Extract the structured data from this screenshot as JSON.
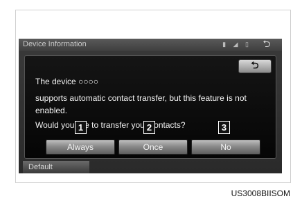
{
  "screen": {
    "title": "Device Information",
    "status_icons": "▮ ◢ ▯",
    "back_icon": "⮌"
  },
  "dialog": {
    "back_icon": "⮌",
    "line1": "The device ○○○○",
    "line2": "supports automatic contact transfer, but this feature is not",
    "line3": "enabled.",
    "line4": "Would you like to transfer your contacts?",
    "buttons": {
      "always": "Always",
      "once": "Once",
      "no": "No"
    }
  },
  "footer": {
    "default_label": "Default"
  },
  "callouts": [
    "1",
    "2",
    "3"
  ],
  "caption": "US3008BIISOM"
}
